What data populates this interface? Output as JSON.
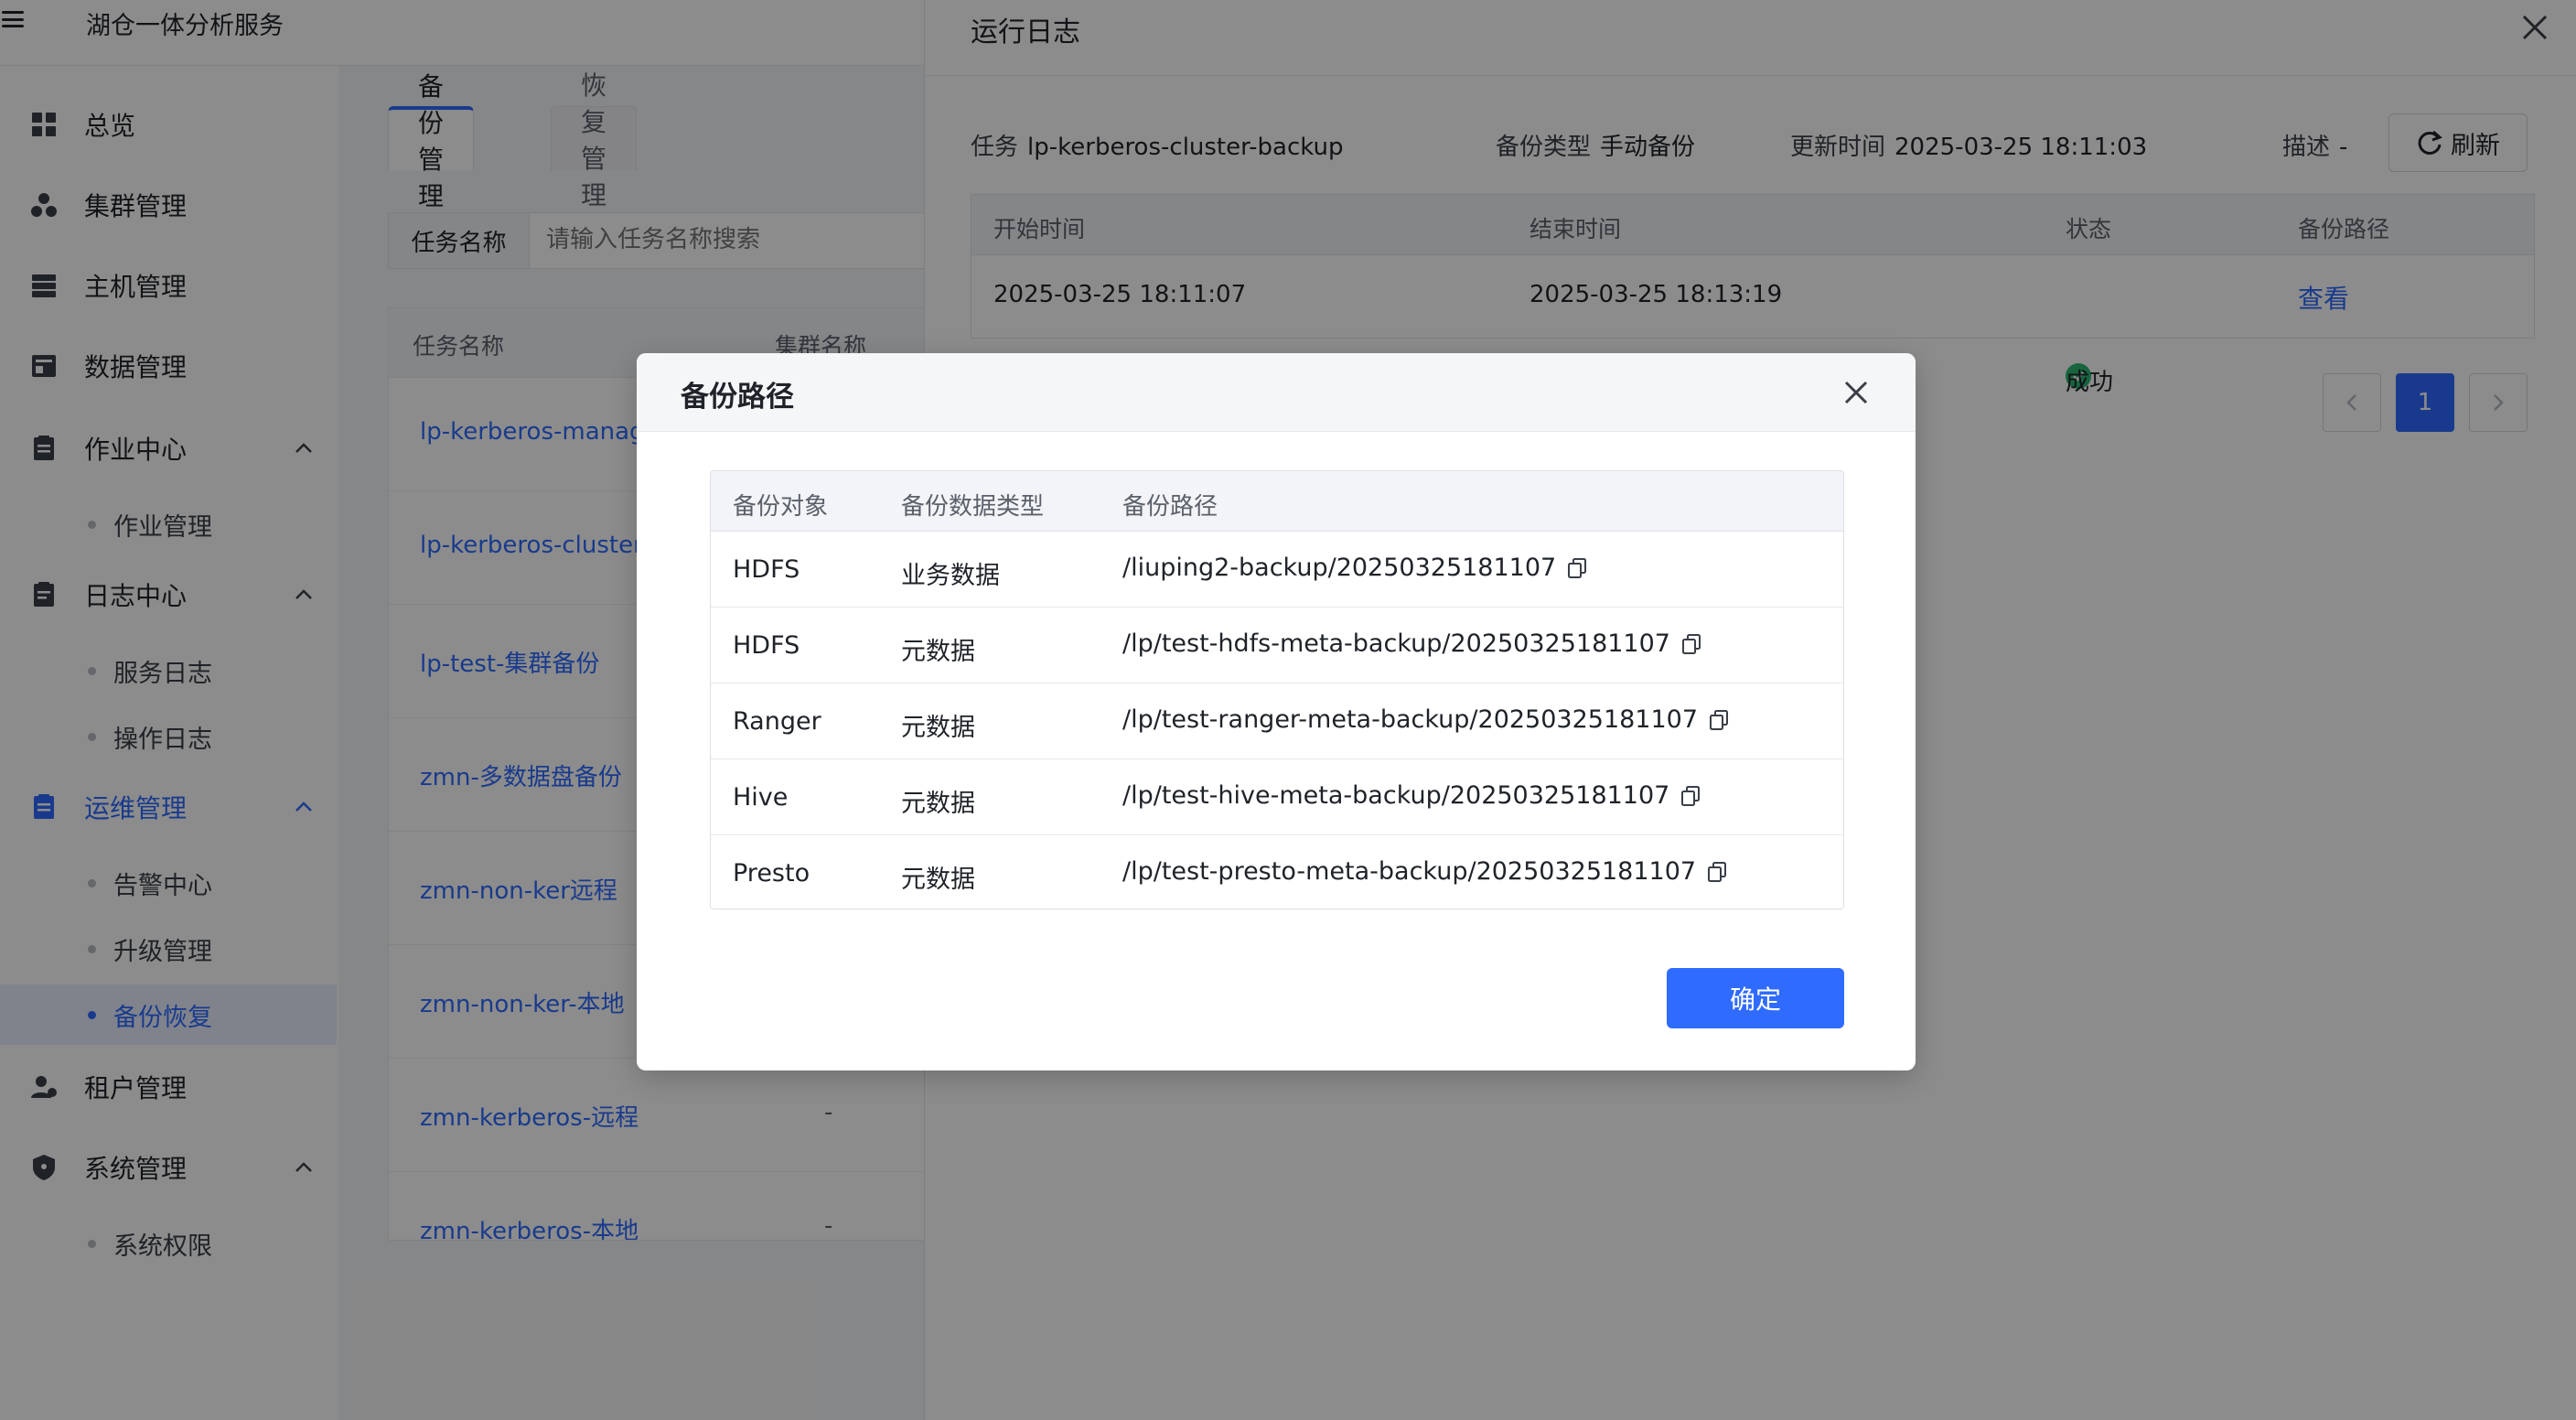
{
  "app": {
    "title": "湖仓一体分析服务"
  },
  "sidebar": {
    "items": [
      {
        "label": "总览",
        "icon": "grid-icon"
      },
      {
        "label": "集群管理",
        "icon": "cluster-icon"
      },
      {
        "label": "主机管理",
        "icon": "server-icon"
      },
      {
        "label": "数据管理",
        "icon": "database-icon"
      },
      {
        "label": "作业中心",
        "icon": "task-icon",
        "expanded": true,
        "children": [
          "作业管理"
        ]
      },
      {
        "label": "日志中心",
        "icon": "log-icon",
        "expanded": true,
        "children": [
          "服务日志",
          "操作日志"
        ]
      },
      {
        "label": "运维管理",
        "icon": "ops-icon",
        "expanded": true,
        "active": true,
        "children": [
          "告警中心",
          "升级管理",
          "备份恢复"
        ],
        "active_child": "备份恢复"
      },
      {
        "label": "租户管理",
        "icon": "user-group-icon"
      },
      {
        "label": "系统管理",
        "icon": "shield-icon",
        "expanded": true,
        "children": [
          "系统权限"
        ]
      }
    ]
  },
  "main": {
    "tabs": [
      {
        "label": "备份管理",
        "active": true
      },
      {
        "label": "恢复管理",
        "active": false
      }
    ],
    "search": {
      "label": "任务名称",
      "placeholder": "请输入任务名称搜索"
    },
    "table": {
      "headers": [
        "任务名称",
        "集群名称"
      ],
      "rows": [
        {
          "name": "lp-kerberos-manage",
          "cluster": ""
        },
        {
          "name": "lp-kerberos-cluster-",
          "cluster": ""
        },
        {
          "name": "lp-test-集群备份",
          "cluster": ""
        },
        {
          "name": "zmn-多数据盘备份",
          "cluster": ""
        },
        {
          "name": "zmn-non-ker远程",
          "cluster": ""
        },
        {
          "name": "zmn-non-ker-本地",
          "cluster": ""
        },
        {
          "name": "zmn-kerberos-远程",
          "cluster": "-"
        },
        {
          "name": "zmn-kerberos-本地",
          "cluster": "-"
        }
      ]
    }
  },
  "drawer": {
    "title": "运行日志",
    "meta": {
      "task_label": "任务",
      "task_value": "lp-kerberos-cluster-backup",
      "type_label": "备份类型",
      "type_value": "手动备份",
      "time_label": "更新时间",
      "time_value": "2025-03-25 18:11:03",
      "desc_label": "描述",
      "desc_value": "-"
    },
    "refresh_label": "刷新",
    "table": {
      "headers": [
        "开始时间",
        "结束时间",
        "状态",
        "备份路径"
      ],
      "rows": [
        {
          "start": "2025-03-25 18:11:07",
          "end": "2025-03-25 18:13:19",
          "status": "成功",
          "path_link": "查看"
        }
      ]
    },
    "pagination": {
      "current": "1"
    }
  },
  "modal": {
    "title": "备份路径",
    "headers": [
      "备份对象",
      "备份数据类型",
      "备份路径"
    ],
    "rows": [
      {
        "object": "HDFS",
        "type": "业务数据",
        "path": "/liuping2-backup/20250325181107"
      },
      {
        "object": "HDFS",
        "type": "元数据",
        "path": "/lp/test-hdfs-meta-backup/20250325181107"
      },
      {
        "object": "Ranger",
        "type": "元数据",
        "path": "/lp/test-ranger-meta-backup/20250325181107"
      },
      {
        "object": "Hive",
        "type": "元数据",
        "path": "/lp/test-hive-meta-backup/20250325181107"
      },
      {
        "object": "Presto",
        "type": "元数据",
        "path": "/lp/test-presto-meta-backup/20250325181107"
      }
    ],
    "confirm_label": "确定"
  },
  "colors": {
    "primary": "#2f6bff",
    "success": "#2bb673",
    "overlay": "rgba(0,0,0,0.45)"
  }
}
